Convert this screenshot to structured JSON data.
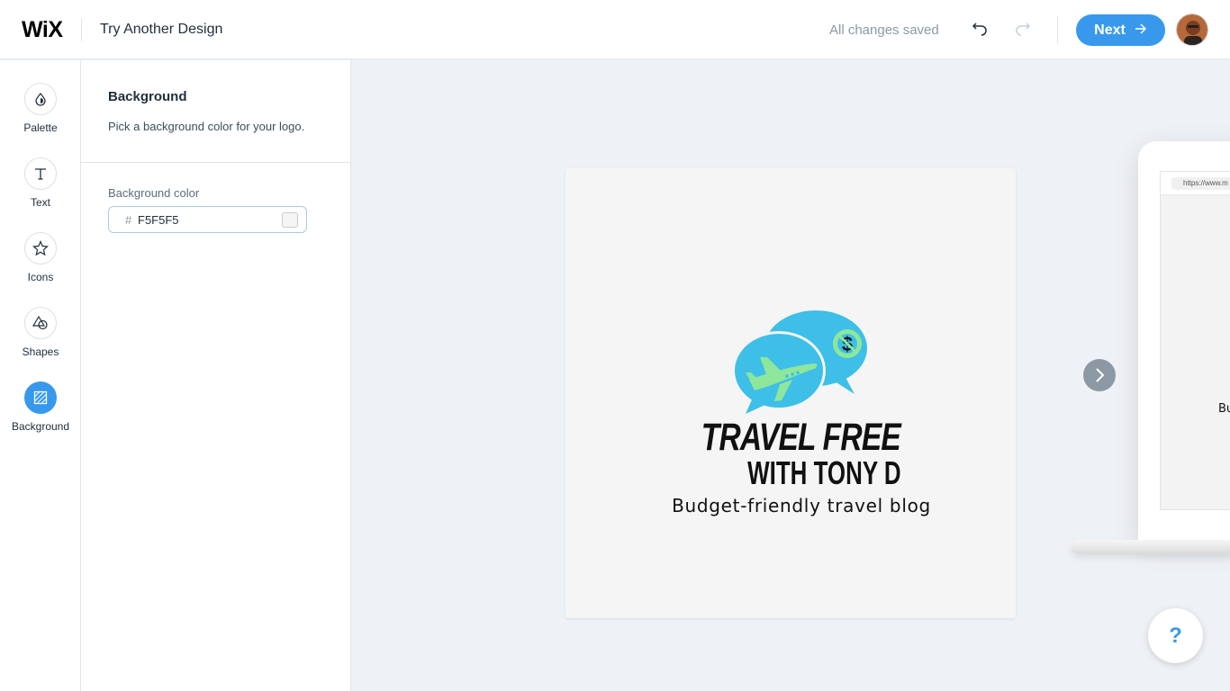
{
  "header": {
    "logo_text": "WiX",
    "title": "Try Another Design",
    "status": "All changes saved",
    "next_label": "Next"
  },
  "nav": {
    "items": [
      {
        "label": "Palette",
        "icon": "palette-icon"
      },
      {
        "label": "Text",
        "icon": "text-icon"
      },
      {
        "label": "Icons",
        "icon": "star-icon"
      },
      {
        "label": "Shapes",
        "icon": "shapes-icon"
      },
      {
        "label": "Background",
        "icon": "background-icon",
        "active": true
      }
    ]
  },
  "panel": {
    "title": "Background",
    "description": "Pick a background color for your logo.",
    "field_label": "Background color",
    "hash": "#",
    "color_value": "F5F5F5"
  },
  "logo": {
    "line1": "TRAVEL FREE",
    "line2": "WITH TONY D",
    "tagline": "Budget-friendly travel blog",
    "background": "#f5f5f5",
    "bubble_color": "#3dbfe8",
    "plane_color": "#8ee69a"
  },
  "preview": {
    "url": "https://www.m",
    "text": "Bu"
  },
  "help": {
    "label": "?"
  },
  "colors": {
    "accent": "#3899ec",
    "text": "#20303c",
    "muted": "#8a9aa8"
  }
}
